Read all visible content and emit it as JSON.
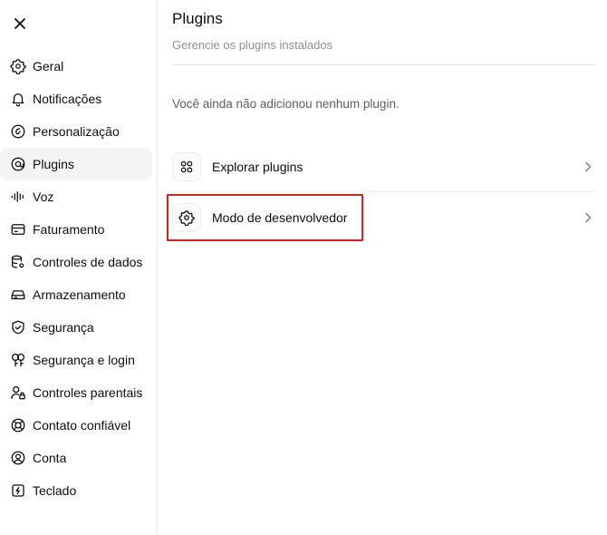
{
  "sidebar": {
    "close_icon": "close-icon",
    "items": [
      {
        "label": "Geral",
        "icon": "gear-icon"
      },
      {
        "label": "Notificações",
        "icon": "bell-icon"
      },
      {
        "label": "Personalização",
        "icon": "personalization-icon"
      },
      {
        "label": "Plugins",
        "icon": "plugin-icon",
        "active": true
      },
      {
        "label": "Voz",
        "icon": "voice-waveform-icon"
      },
      {
        "label": "Faturamento",
        "icon": "credit-card-icon"
      },
      {
        "label": "Controles de dados",
        "icon": "database-settings-icon"
      },
      {
        "label": "Armazenamento",
        "icon": "storage-drive-icon"
      },
      {
        "label": "Segurança",
        "icon": "shield-check-icon"
      },
      {
        "label": "Segurança e login",
        "icon": "key-icon"
      },
      {
        "label": "Controles parentais",
        "icon": "user-lock-icon"
      },
      {
        "label": "Contato confiável",
        "icon": "lifebuoy-icon"
      },
      {
        "label": "Conta",
        "icon": "user-circle-icon"
      },
      {
        "label": "Teclado",
        "icon": "keyboard-icon"
      }
    ]
  },
  "main": {
    "title": "Plugins",
    "subtitle": "Gerencie os plugins instalados",
    "empty_message": "Você ainda não adicionou nenhum plugin.",
    "rows": [
      {
        "label": "Explorar plugins",
        "icon": "grid-icon"
      },
      {
        "label": "Modo de desenvolvedor",
        "icon": "gear-icon"
      }
    ]
  },
  "highlight_color": "#d21f1f"
}
